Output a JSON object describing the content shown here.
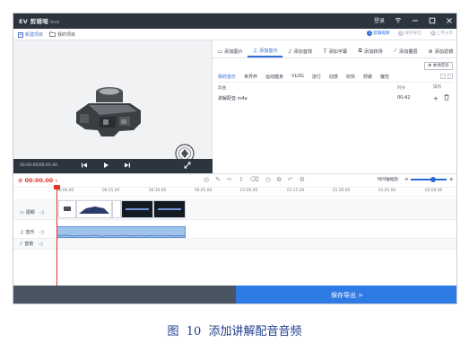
{
  "window": {
    "app_name": "EV 剪辑喵",
    "edition": "Beta"
  },
  "titlebar": {
    "login": "登录",
    "wifi_icon": "wifi-icon",
    "min_icon": "minimize-icon",
    "max_icon": "maximize-icon",
    "close_icon": "close-icon"
  },
  "toolbar": {
    "new_project": "新建项目",
    "my_projects": "我的项目"
  },
  "steps": [
    {
      "num": "1",
      "label": "剪辑视频",
      "active": true
    },
    {
      "num": "2",
      "label": "保存导出",
      "active": false
    },
    {
      "num": "3",
      "label": "上传分享",
      "active": false
    }
  ],
  "player": {
    "time": "00:00:00/00:01:40"
  },
  "panel": {
    "tabs": [
      {
        "icon": "video-icon",
        "label": "添加图片"
      },
      {
        "icon": "music-icon",
        "label": "添加音乐"
      },
      {
        "icon": "sound-effect-icon",
        "label": "添加音效"
      },
      {
        "icon": "text-icon",
        "label": "添加字幕"
      },
      {
        "icon": "transition-icon",
        "label": "添加转场"
      },
      {
        "icon": "overlay-icon",
        "label": "添加叠层"
      },
      {
        "icon": "filter-icon",
        "label": "添加滤镜"
      }
    ],
    "active_tab": 1,
    "local_music": "本地音乐",
    "categories": [
      "我的音乐",
      "世界杯",
      "运动健身",
      "VLOG",
      "流行",
      "动感",
      "欢快",
      "舒缓",
      "魔性"
    ],
    "active_category": 0,
    "columns": {
      "name": "歌曲",
      "duration": "时长",
      "ops": "操作"
    },
    "rows": [
      {
        "name": "讲解配音.m4a",
        "duration": "00:42"
      }
    ]
  },
  "timeline": {
    "current_time": "00:00.00",
    "zoom_label": "时间轴缩放：",
    "ticks": [
      "00:00.00",
      "00:15.00",
      "00:30.00",
      "00:45.00",
      "01:00.00",
      "01:15.00",
      "01:30.00",
      "01:45.00",
      "02:00.00"
    ],
    "tracks": [
      {
        "icon": "video-track-icon",
        "label": "视频"
      },
      {
        "icon": "music-track-icon",
        "label": "音乐"
      },
      {
        "icon": "sound-track-icon",
        "label": "音效"
      }
    ]
  },
  "bottom": {
    "export": "保存导出 >"
  },
  "caption": "图  10  添加讲解配音音频",
  "colors": {
    "accent": "#2b6ad8",
    "playhead": "#e0352b",
    "titlebar": "#2c3440",
    "export": "#2f7be6"
  }
}
